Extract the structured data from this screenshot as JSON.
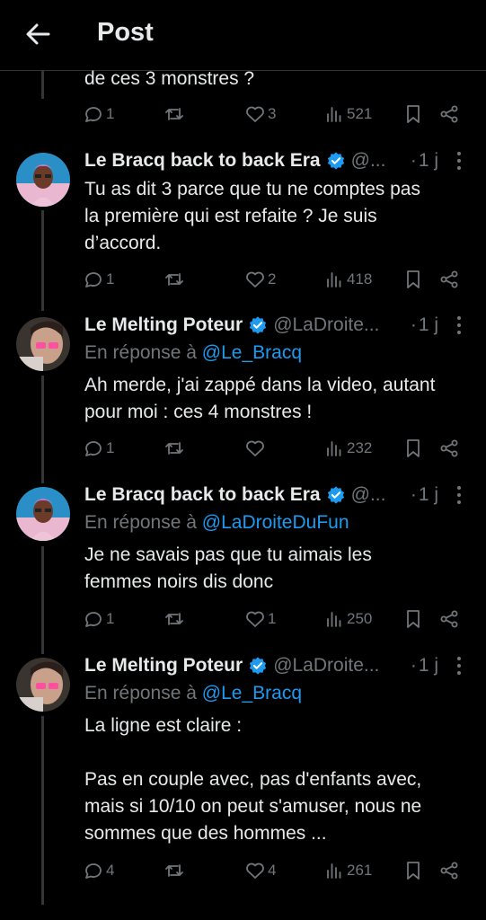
{
  "header": {
    "title": "Post"
  },
  "colors": {
    "accent": "#1d9bf0",
    "muted": "#71767b",
    "text": "#e7e9ea",
    "background": "#000000"
  },
  "top_post": {
    "text": "de ces 3 monstres ?",
    "replies": "1",
    "retweets": "",
    "likes": "3",
    "views": "521"
  },
  "posts": [
    {
      "name": "Le Bracq back to back Era",
      "handle": "@...",
      "time": "1 j",
      "verified": true,
      "reply_label": "",
      "reply_mention": "",
      "text": "Tu as dit 3 parce que tu ne comptes pas\nla première qui est refaite ? Je suis\nd’accord.",
      "replies": "1",
      "retweets": "",
      "likes": "2",
      "views": "418"
    },
    {
      "name": "Le Melting Poteur",
      "handle": "@LaDroite...",
      "time": "1 j",
      "verified": true,
      "reply_label": "En réponse à",
      "reply_mention": "@Le_Bracq",
      "text": "Ah merde, j'ai zappé dans la video, autant\npour moi : ces 4 monstres !",
      "replies": "1",
      "retweets": "",
      "likes": "",
      "views": "232"
    },
    {
      "name": "Le Bracq back to back Era",
      "handle": "@...",
      "time": "1 j",
      "verified": true,
      "reply_label": "En réponse à",
      "reply_mention": "@LaDroiteDuFun",
      "text": "Je ne savais pas que tu aimais les\nfemmes noirs dis donc",
      "replies": "1",
      "retweets": "",
      "likes": "1",
      "views": "250"
    },
    {
      "name": "Le Melting Poteur",
      "handle": "@LaDroite...",
      "time": "1 j",
      "verified": true,
      "reply_label": "En réponse à",
      "reply_mention": "@Le_Bracq",
      "text": "La ligne est claire :\n\nPas en couple avec, pas d'enfants avec,\nmais si 10/10 on peut s'amuser, nous ne\nsommes que des hommes ...",
      "replies": "4",
      "retweets": "",
      "likes": "4",
      "views": "261"
    }
  ]
}
